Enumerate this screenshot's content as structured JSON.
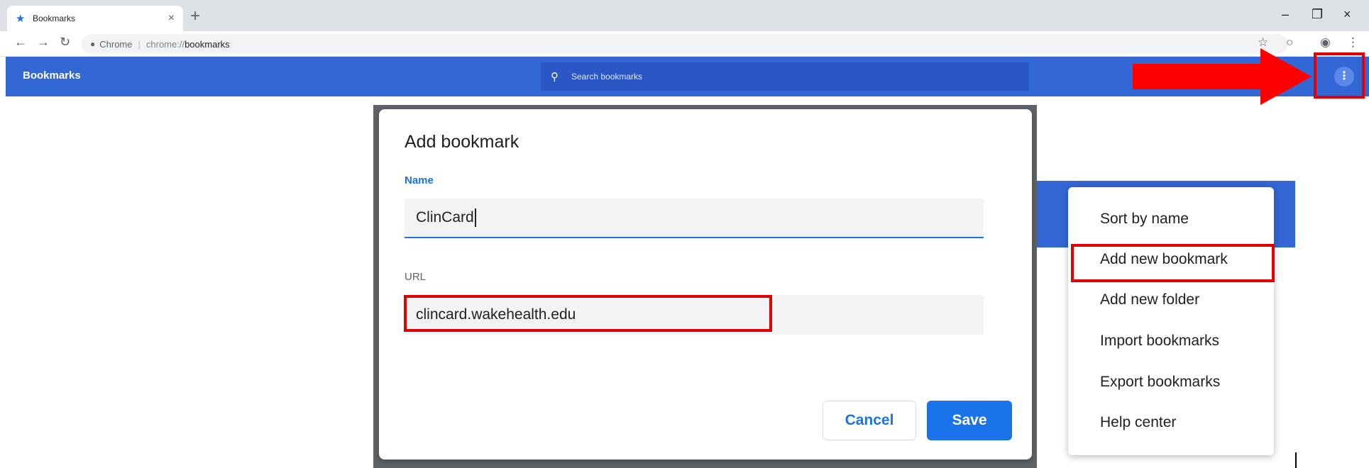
{
  "browser": {
    "tab_title": "Bookmarks",
    "tab_close": "×",
    "new_tab": "+",
    "omnibox_site": "Chrome",
    "omnibox_scheme": "chrome://",
    "omnibox_host": "bookmarks",
    "window_controls": {
      "minimize": "–",
      "restore": "❐",
      "close": "×"
    }
  },
  "header": {
    "title": "Bookmarks",
    "search_placeholder": "Search bookmarks"
  },
  "dialog": {
    "title": "Add bookmark",
    "name_label": "Name",
    "name_value": "ClinCard",
    "url_label": "URL",
    "url_value": "clincard.wakehealth.edu",
    "cancel_label": "Cancel",
    "save_label": "Save"
  },
  "menu": {
    "items": [
      {
        "label": "Sort by name"
      },
      {
        "label": "Add new bookmark"
      },
      {
        "label": "Add new folder"
      },
      {
        "label": "Import bookmarks"
      },
      {
        "label": "Export bookmarks"
      },
      {
        "label": "Help center"
      }
    ]
  },
  "colors": {
    "header_bg": "#3367d6",
    "accent": "#1a73e8",
    "annotation_red": "#e30000"
  },
  "icons": [
    "star-icon",
    "back-icon",
    "forward-icon",
    "reload-icon",
    "site-info-icon",
    "bookmark-star-icon",
    "extension-icon",
    "profile-icon",
    "chrome-menu-icon",
    "search-icon",
    "kebab-menu-icon"
  ]
}
